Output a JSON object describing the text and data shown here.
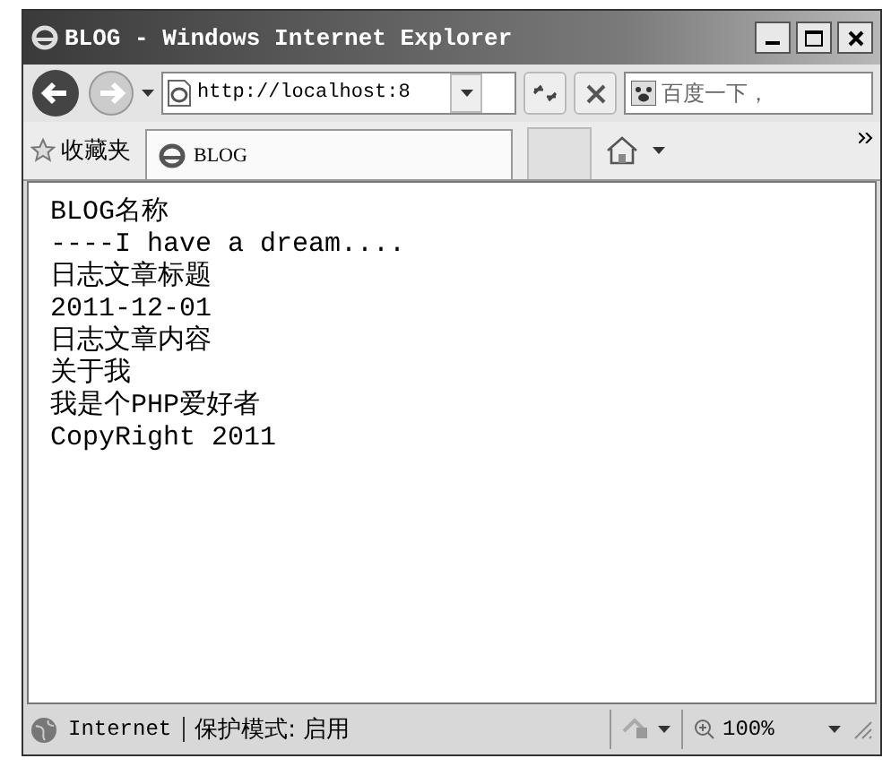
{
  "window": {
    "title": "BLOG - Windows Internet Explorer"
  },
  "address_bar": {
    "value": "http://localhost:8"
  },
  "search": {
    "placeholder": "百度一下，"
  },
  "favorites": {
    "label": "收藏夹"
  },
  "tabs": [
    {
      "label": "BLOG",
      "selected": true
    }
  ],
  "page_lines": [
    "BLOG名称",
    "----I have a dream....",
    "日志文章标题",
    "2011-12-01",
    "日志文章内容",
    "关于我",
    "我是个PHP爱好者",
    "CopyRight 2011"
  ],
  "status_bar": {
    "zone": "Internet",
    "protected_mode": "保护模式: 启用",
    "zoom": "100%"
  }
}
